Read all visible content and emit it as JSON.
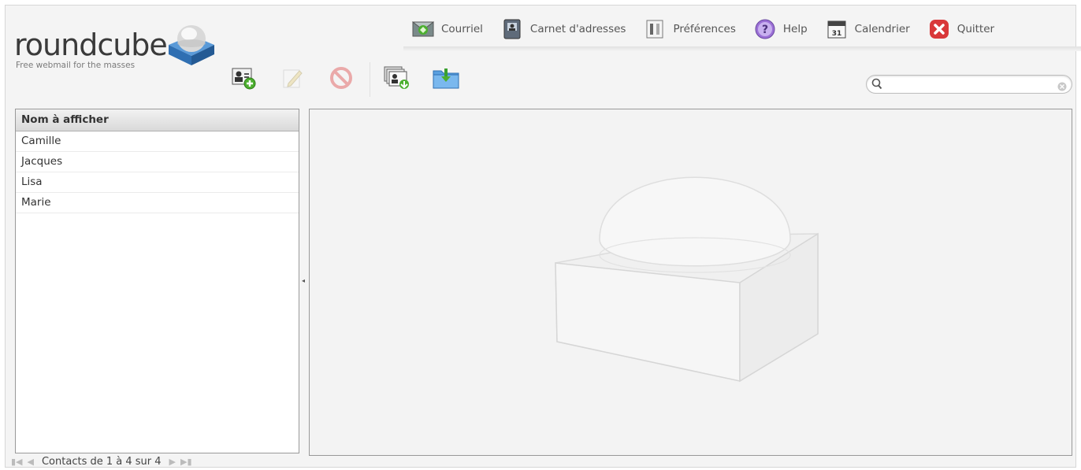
{
  "app": {
    "logo_word": "roundcube",
    "logo_tagline": "Free webmail for the masses",
    "brand_color": "#3b7cc4"
  },
  "topnav": {
    "items": [
      {
        "label": "Courriel",
        "icon": "mail-icon"
      },
      {
        "label": "Carnet d'adresses",
        "icon": "addressbook-icon"
      },
      {
        "label": "Préférences",
        "icon": "preferences-icon"
      },
      {
        "label": "Help",
        "icon": "help-icon"
      },
      {
        "label": "Calendrier",
        "icon": "calendar-icon"
      },
      {
        "label": "Quitter",
        "icon": "logout-icon"
      }
    ]
  },
  "toolbar": {
    "buttons": [
      {
        "icon": "add-contact-icon",
        "enabled": true
      },
      {
        "icon": "edit-contact-icon",
        "enabled": false
      },
      {
        "icon": "delete-contact-icon",
        "enabled": false
      },
      {
        "icon": "import-contacts-icon",
        "enabled": true
      },
      {
        "icon": "export-contacts-icon",
        "enabled": true
      }
    ]
  },
  "search": {
    "value": "",
    "placeholder": ""
  },
  "contacts": {
    "header": "Nom à afficher",
    "rows": [
      "Camille",
      "Jacques",
      "Lisa",
      "Marie"
    ]
  },
  "footer": {
    "count_text": "Contacts de 1 à 4 sur 4"
  },
  "calendar_icon_text": "31"
}
